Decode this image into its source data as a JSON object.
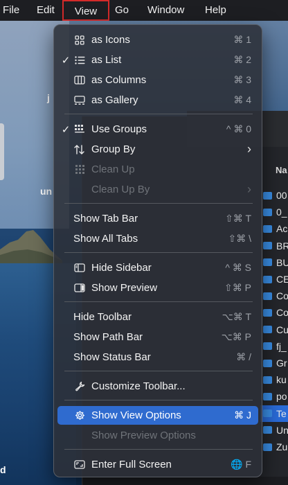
{
  "menubar": {
    "items": [
      "File",
      "Edit",
      "View",
      "Go",
      "Window",
      "Help"
    ]
  },
  "desktop": {
    "labels": [
      "j",
      "un",
      "d"
    ]
  },
  "finder": {
    "column_header": "Na",
    "files": [
      "00",
      "0_",
      "Ac",
      "BR",
      "BU",
      "CE",
      "Co",
      "Co",
      "Cu",
      "fj_",
      "Gr",
      "ku",
      "po",
      "Te",
      "Un",
      "Zu"
    ]
  },
  "view_menu": {
    "items": [
      {
        "label": "as Icons",
        "shortcut": "⌘ 1",
        "icon": "grid-icon"
      },
      {
        "label": "as List",
        "shortcut": "⌘ 2",
        "icon": "list-icon",
        "checked": true
      },
      {
        "label": "as Columns",
        "shortcut": "⌘ 3",
        "icon": "columns-icon"
      },
      {
        "label": "as Gallery",
        "shortcut": "⌘ 4",
        "icon": "gallery-icon"
      },
      {
        "label": "Use Groups",
        "shortcut": "^ ⌘ 0",
        "icon": "groups-icon",
        "checked": true
      },
      {
        "label": "Group By",
        "shortcut": "›",
        "icon": "sort-arrows-icon"
      },
      {
        "label": "Clean Up",
        "shortcut": "",
        "icon": "grid-icon",
        "disabled": true
      },
      {
        "label": "Clean Up By",
        "shortcut": "›",
        "disabled": true
      },
      {
        "label": "Show Tab Bar",
        "shortcut": "⇧⌘ T"
      },
      {
        "label": "Show All Tabs",
        "shortcut": "⇧⌘ \\"
      },
      {
        "label": "Hide Sidebar",
        "shortcut": "^ ⌘ S",
        "icon": "sidebar-icon"
      },
      {
        "label": "Show Preview",
        "shortcut": "⇧⌘ P",
        "icon": "preview-pane-icon"
      },
      {
        "label": "Hide Toolbar",
        "shortcut": "⌥⌘ T"
      },
      {
        "label": "Show Path Bar",
        "shortcut": "⌥⌘ P"
      },
      {
        "label": "Show Status Bar",
        "shortcut": "⌘ /"
      },
      {
        "label": "Customize Toolbar...",
        "shortcut": "",
        "icon": "wrench-icon"
      },
      {
        "label": "Show View Options",
        "shortcut": "⌘ J",
        "icon": "gear-icon",
        "highlighted": true
      },
      {
        "label": "Show Preview Options",
        "shortcut": "",
        "disabled": true
      },
      {
        "label": "Enter Full Screen",
        "shortcut": "🌐 F",
        "icon": "fullscreen-icon"
      }
    ]
  },
  "colors": {
    "menu_bg": "#2c3038",
    "highlight": "#2f6bcf",
    "view_outline": "#d42a2a",
    "folder_blue": "#3a8ee6"
  }
}
